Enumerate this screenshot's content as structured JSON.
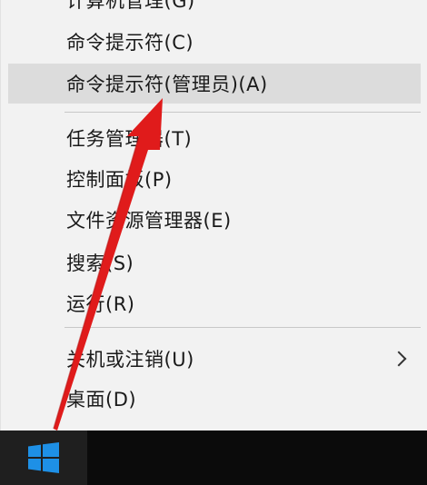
{
  "menu": {
    "items": [
      {
        "label": "计算机管理(G)"
      },
      {
        "label": "命令提示符(C)"
      },
      {
        "label": "命令提示符(管理员)(A)"
      },
      {
        "label": "任务管理器(T)"
      },
      {
        "label": "控制面板(P)"
      },
      {
        "label": "文件资源管理器(E)"
      },
      {
        "label": "搜索(S)"
      },
      {
        "label": "运行(R)"
      },
      {
        "label": "关机或注销(U)"
      },
      {
        "label": "桌面(D)"
      }
    ]
  },
  "taskbar": {
    "start_icon": "windows-logo-icon"
  },
  "colors": {
    "menu_bg": "#f2f2f2",
    "highlight": "#dcdcdc",
    "taskbar": "#0b0b0b",
    "windows_blue": "#1e90e6",
    "annotation_red": "#e01b1b"
  }
}
